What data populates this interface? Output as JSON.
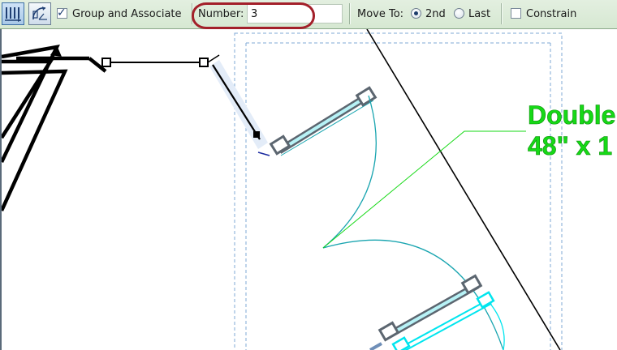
{
  "options_bar": {
    "tools": [
      {
        "icon": "dimension-tool-icon",
        "active": true
      },
      {
        "icon": "radial-dimension-icon",
        "active": false
      }
    ],
    "group_and_associate": {
      "label": "Group and Associate",
      "checked": true
    },
    "number": {
      "label": "Number:",
      "value": "3"
    },
    "move_to": {
      "label": "Move To:",
      "options": [
        {
          "label": "2nd",
          "selected": true
        },
        {
          "label": "Last",
          "selected": false
        }
      ]
    },
    "constrain": {
      "label": "Constrain",
      "checked": false
    }
  },
  "canvas": {
    "door_tag": {
      "line1": "Double",
      "line2": "48\" x 1"
    }
  },
  "colors": {
    "options_bar_bg": "#d6e8d2",
    "highlight_ellipse": "#a3202a",
    "tag_text": "#16d916",
    "door_swing": "#1aa5b0",
    "door_selected": "#00e5ee",
    "crop_region": "#7fa9d6"
  }
}
